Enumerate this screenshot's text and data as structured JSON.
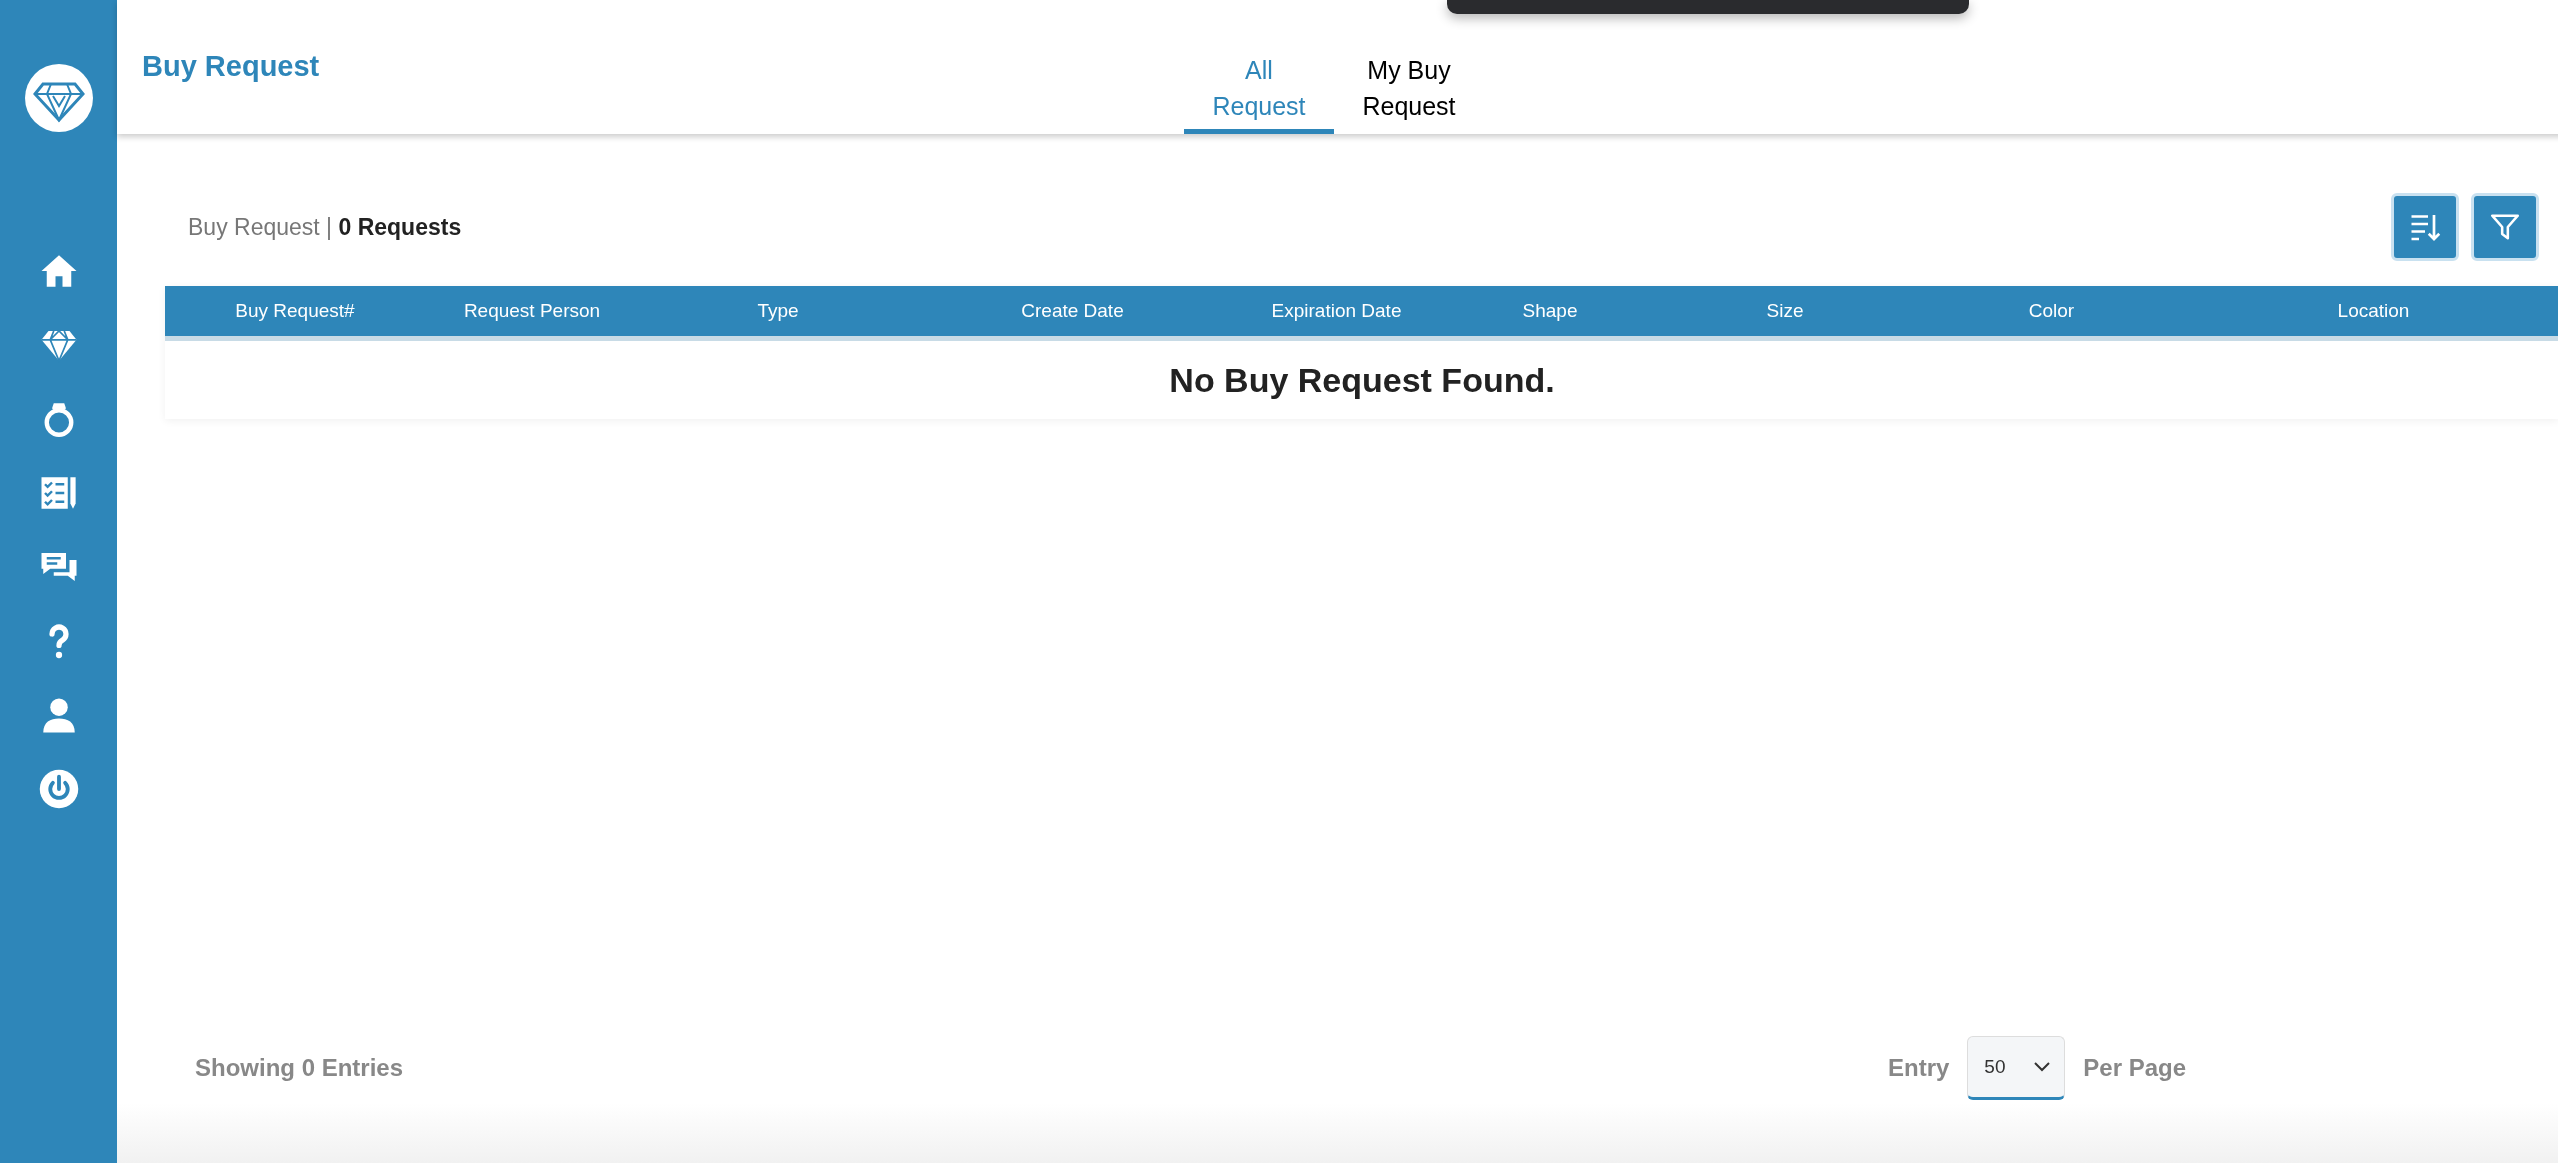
{
  "header": {
    "title": "Buy Request",
    "tabs": [
      {
        "label": "All Request",
        "selected": true
      },
      {
        "label": "My Buy Request",
        "selected": false
      }
    ]
  },
  "summary": {
    "label": "Buy Request",
    "separator": "|",
    "count": "0 Requests"
  },
  "table": {
    "columns": [
      "Buy Request#",
      "Request Person",
      "Type",
      "Create Date",
      "Expiration Date",
      "Shape",
      "Size",
      "Color",
      "Location"
    ],
    "empty_message": "No Buy Request Found."
  },
  "footer": {
    "showing": "Showing 0 Entries",
    "entry_label": "Entry",
    "per_page": "50",
    "per_page_label": "Per Page"
  }
}
